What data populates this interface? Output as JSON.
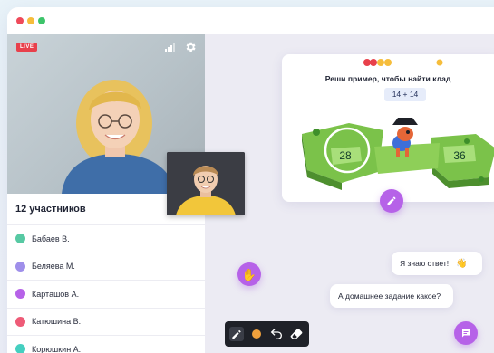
{
  "window": {
    "title_dots": [
      "#ef4a5a",
      "#f6bd3b",
      "#3dc46a"
    ]
  },
  "video": {
    "live_label": "LIVE",
    "signal_icon": "signal-bars-icon",
    "settings_icon": "gear-icon"
  },
  "participants": {
    "title": "12 участников",
    "items": [
      {
        "name": "Бабаев В.",
        "color": "#57c9a3"
      },
      {
        "name": "Беляева М.",
        "color": "#9f8fea"
      },
      {
        "name": "Карташов А.",
        "color": "#b662e8"
      },
      {
        "name": "Катюшина В.",
        "color": "#ee5b77"
      },
      {
        "name": "Корюшкин А.",
        "color": "#45cfc0"
      }
    ]
  },
  "task": {
    "title": "Реши пример, чтобы найти клад",
    "example": "14 + 14",
    "answers": [
      "28",
      "36"
    ],
    "progress_colors": [
      "#e8404b",
      "#e8404b",
      "#f6bd3b",
      "#f6bd3b",
      "#f6bd3b"
    ]
  },
  "chat": {
    "message_1": "Я знаю ответ!",
    "message_2": "А домашнее задание какое?"
  },
  "toolbar": {
    "tools": [
      "pen-icon",
      "color-dot-icon",
      "undo-icon",
      "eraser-icon"
    ],
    "pen_color": "#f0a03c"
  },
  "accent": "#b662e8"
}
